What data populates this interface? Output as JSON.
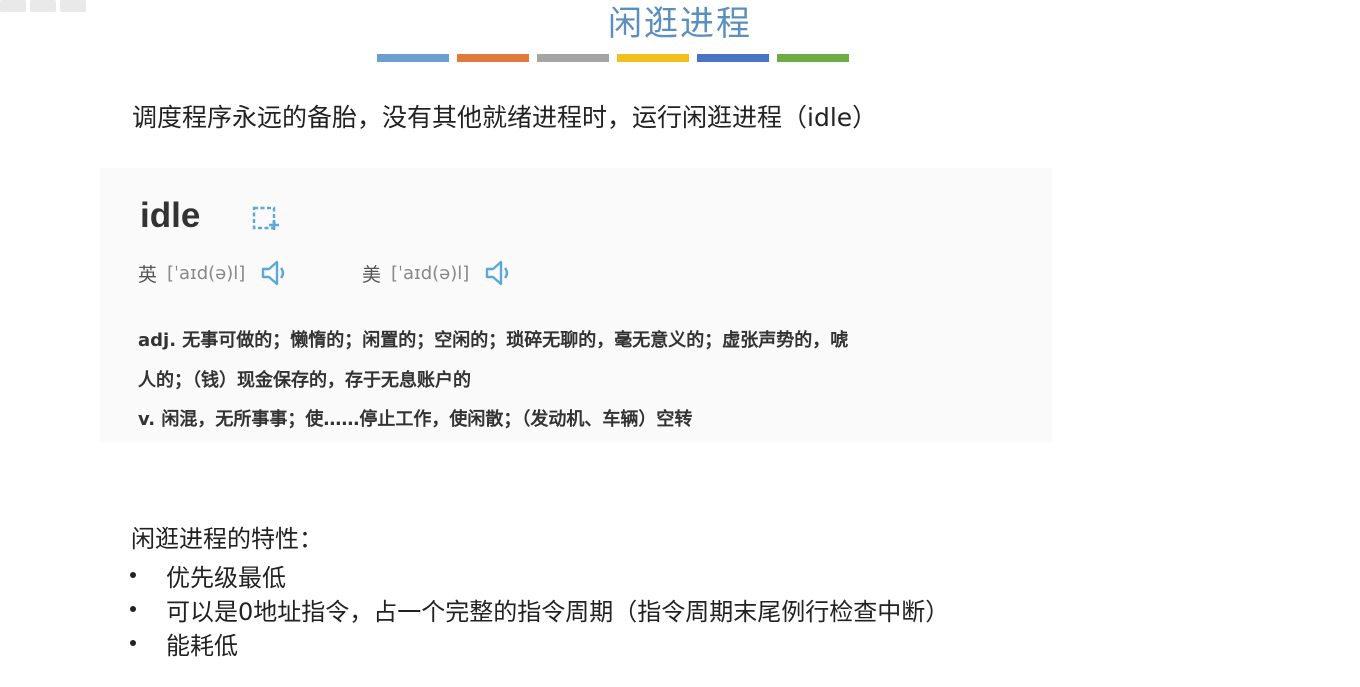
{
  "slide": {
    "title": "闲逛进程",
    "subtitle": "调度程序永远的备胎，没有其他就绪进程时，运行闲逛进程（idle）"
  },
  "color_bars": [
    "#6b9fd4",
    "#e07b3a",
    "#a5a5a5",
    "#f2bf1c",
    "#4a74c4",
    "#6fac46"
  ],
  "dictionary": {
    "word": "idle",
    "add_icon": "add-to-wordbook-icon",
    "uk_label": "英",
    "uk_ipa": "[ˈaɪd(ə)l]",
    "us_label": "美",
    "us_ipa": "[ˈaɪd(ə)l]",
    "speaker_icon": "speaker-icon",
    "definitions": [
      "adj. 无事可做的；懒惰的；闲置的；空闲的；琐碎无聊的，毫无意义的；虚张声势的，唬",
      "人的；（钱）现金保存的，存于无息账户的",
      "v. 闲混，无所事事；使……停止工作，使闲散；（发动机、车辆）空转"
    ]
  },
  "properties": {
    "title": "闲逛进程的特性：",
    "items": [
      "优先级最低",
      "可以是0地址指令，占一个完整的指令周期（指令周期末尾例行检查中断）",
      "能耗低"
    ]
  },
  "accent_color": "#5b8fbf",
  "icon_color": "#5aa9dc"
}
